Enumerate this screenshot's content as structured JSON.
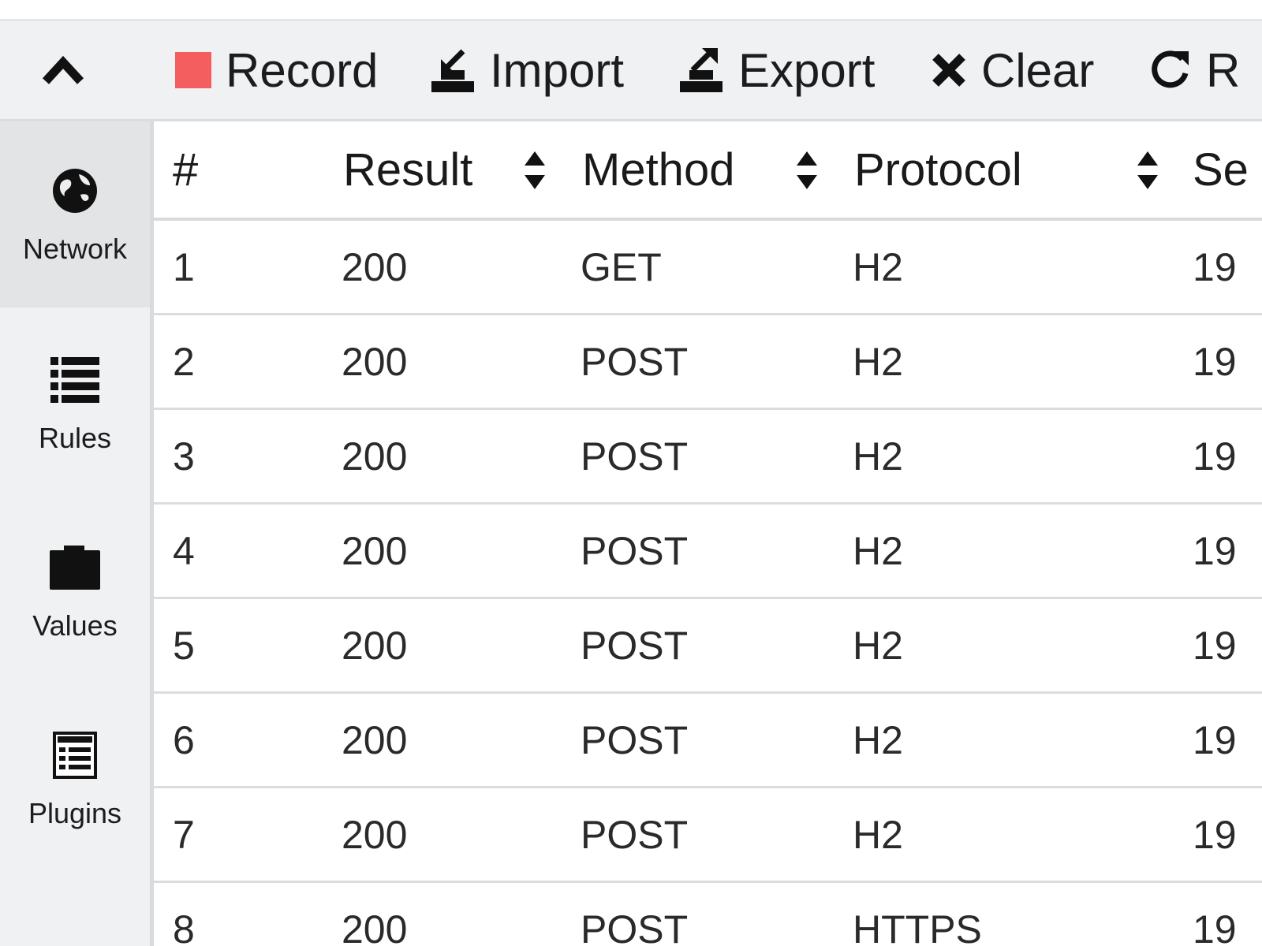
{
  "toolbar": {
    "record_label": "Record",
    "import_label": "Import",
    "export_label": "Export",
    "clear_label": "Clear",
    "replay_label": "R",
    "record_color": "#f55e5e"
  },
  "sidebar": {
    "items": [
      {
        "label": "Network",
        "icon": "globe-icon",
        "active": true
      },
      {
        "label": "Rules",
        "icon": "list-icon",
        "active": false
      },
      {
        "label": "Values",
        "icon": "folder-icon",
        "active": false
      },
      {
        "label": "Plugins",
        "icon": "plugin-list-icon",
        "active": false
      }
    ]
  },
  "table": {
    "columns": [
      "#",
      "Result",
      "Method",
      "Protocol",
      "Se"
    ],
    "rows": [
      {
        "num": "1",
        "result": "200",
        "method": "GET",
        "protocol": "H2",
        "server": "19"
      },
      {
        "num": "2",
        "result": "200",
        "method": "POST",
        "protocol": "H2",
        "server": "19"
      },
      {
        "num": "3",
        "result": "200",
        "method": "POST",
        "protocol": "H2",
        "server": "19"
      },
      {
        "num": "4",
        "result": "200",
        "method": "POST",
        "protocol": "H2",
        "server": "19"
      },
      {
        "num": "5",
        "result": "200",
        "method": "POST",
        "protocol": "H2",
        "server": "19"
      },
      {
        "num": "6",
        "result": "200",
        "method": "POST",
        "protocol": "H2",
        "server": "19"
      },
      {
        "num": "7",
        "result": "200",
        "method": "POST",
        "protocol": "H2",
        "server": "19"
      },
      {
        "num": "8",
        "result": "200",
        "method": "POST",
        "protocol": "HTTPS",
        "server": "19"
      }
    ]
  }
}
